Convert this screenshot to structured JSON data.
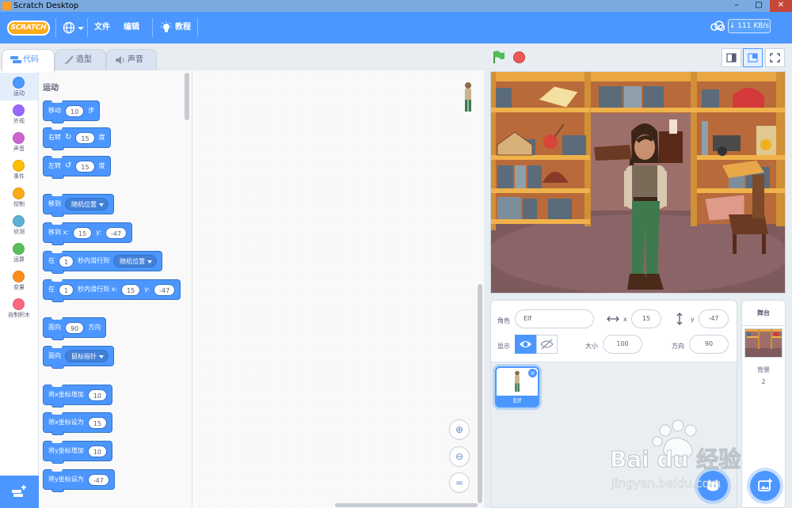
{
  "window": {
    "title": "Scratch Desktop"
  },
  "menubar": {
    "logo_text": "SCRATCH",
    "file_label": "文件",
    "edit_label": "编辑",
    "tutorial_label": "教程",
    "net_speed": "111 KB/s"
  },
  "tabs": [
    {
      "label": "代码",
      "icon": "code-icon"
    },
    {
      "label": "造型",
      "icon": "brush-icon"
    },
    {
      "label": "声音",
      "icon": "speaker-icon"
    }
  ],
  "categories": [
    {
      "label": "运动",
      "color": "#4c97ff"
    },
    {
      "label": "外观",
      "color": "#9966ff"
    },
    {
      "label": "声音",
      "color": "#cf63cf"
    },
    {
      "label": "事件",
      "color": "#ffbf00"
    },
    {
      "label": "控制",
      "color": "#ffab19"
    },
    {
      "label": "侦测",
      "color": "#5cb1d6"
    },
    {
      "label": "运算",
      "color": "#59c059"
    },
    {
      "label": "变量",
      "color": "#ff8c1a"
    },
    {
      "label": "自制积木",
      "color": "#ff6680"
    }
  ],
  "palette": {
    "section_title": "运动",
    "blocks": {
      "move": {
        "a": "移动",
        "v": "10",
        "b": "步"
      },
      "turn_right": {
        "a": "右转",
        "v": "15",
        "b": "度"
      },
      "turn_left": {
        "a": "左转",
        "v": "15",
        "b": "度"
      },
      "goto": {
        "a": "移到",
        "d": "随机位置"
      },
      "goto_xy": {
        "a": "移到 x:",
        "x": "15",
        "b": "y:",
        "y": "-47"
      },
      "glide": {
        "a": "在",
        "v": "1",
        "b": "秒内滑行到",
        "d": "随机位置"
      },
      "glide_xy": {
        "a": "在",
        "v": "1",
        "b": "秒内滑行到 x:",
        "x": "15",
        "c": "y:",
        "y": "-47"
      },
      "point_dir": {
        "a": "面向",
        "v": "90",
        "b": "方向"
      },
      "point_towards": {
        "a": "面向",
        "d": "鼠标指针"
      },
      "change_x": {
        "a": "将x坐标增加",
        "v": "10"
      },
      "set_x": {
        "a": "将x坐标设为",
        "v": "15"
      },
      "change_y": {
        "a": "将y坐标增加",
        "v": "10"
      },
      "set_y": {
        "a": "将y坐标设为",
        "v": "-47"
      }
    }
  },
  "sprite_info": {
    "sprite_label": "角色",
    "sprite_name": "Elf",
    "x_label": "x",
    "x_value": "15",
    "y_label": "y",
    "y_value": "-47",
    "show_label": "显示",
    "size_label": "大小",
    "size_value": "100",
    "direction_label": "方向",
    "direction_value": "90"
  },
  "sprites": [
    {
      "name": "Elf"
    }
  ],
  "stage_pane": {
    "title": "舞台",
    "backdrop_label": "背景",
    "backdrop_count": "2"
  },
  "watermark": {
    "brand": "Bai du 经验",
    "url": "jingyan.baidu.com"
  },
  "colors": {
    "accent": "#4c97ff",
    "logo": "#ffab19",
    "flag": "#4cbf56",
    "stop": "#ec5959"
  }
}
